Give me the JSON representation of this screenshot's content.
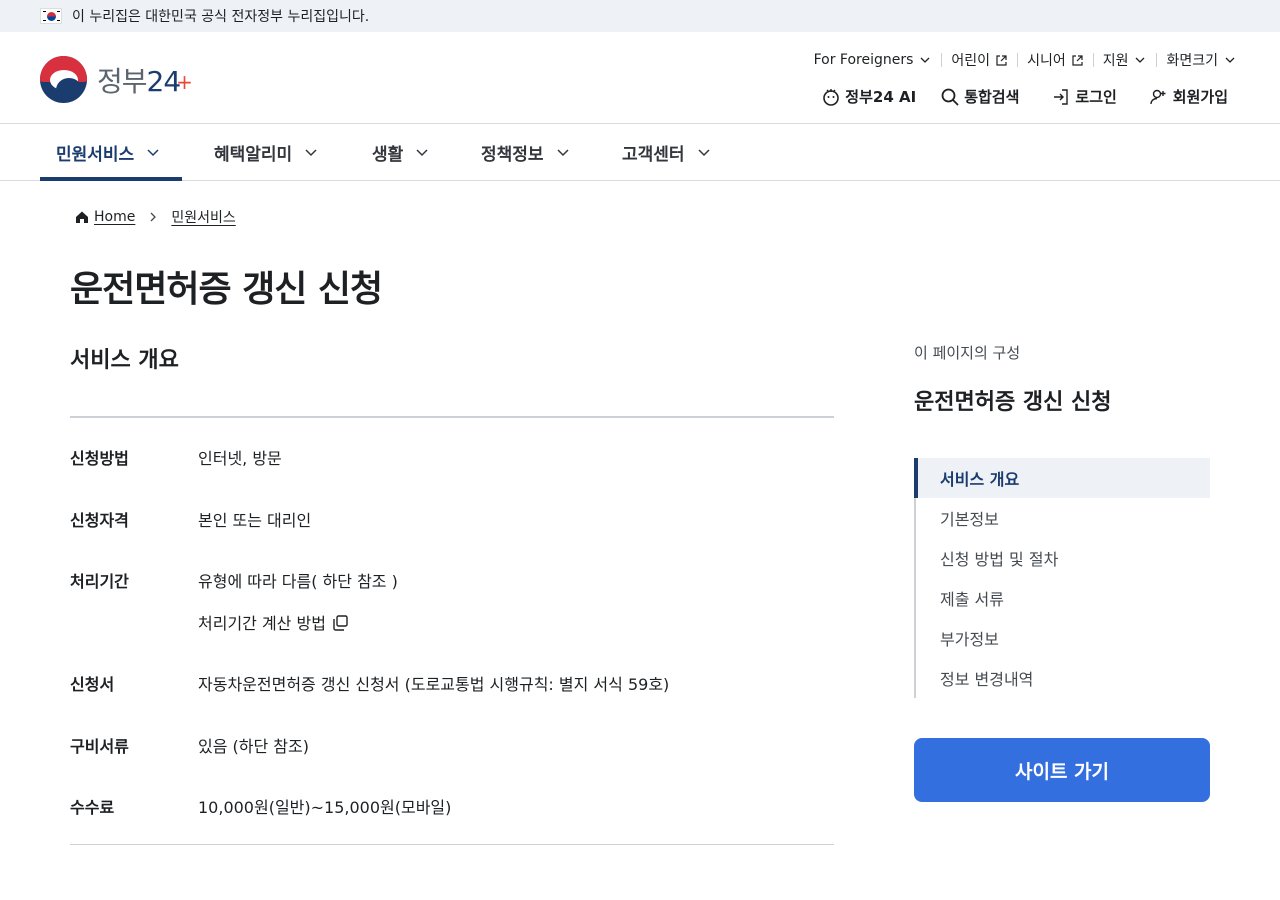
{
  "gov_banner": {
    "text": "이 누리집은 대한민국 공식 전자정부 누리집입니다."
  },
  "logo": {
    "text_main": "정부",
    "text_num": "24",
    "text_plus": "+"
  },
  "util_menu": [
    {
      "label": "For Foreigners",
      "icon": "chevron-down-icon"
    },
    {
      "label": "어린이",
      "icon": "external-link-icon"
    },
    {
      "label": "시니어",
      "icon": "external-link-icon"
    },
    {
      "label": "지원",
      "icon": "chevron-down-icon"
    },
    {
      "label": "화면크기",
      "icon": "chevron-down-icon"
    }
  ],
  "header_actions": {
    "ai": "정부24 AI",
    "search": "통합검색",
    "login": "로그인",
    "signup": "회원가입"
  },
  "nav": [
    {
      "label": "민원서비스",
      "active": true
    },
    {
      "label": "혜택알리미"
    },
    {
      "label": "생활"
    },
    {
      "label": "정책정보"
    },
    {
      "label": "고객센터"
    }
  ],
  "breadcrumb": {
    "home": "Home",
    "current": "민원서비스"
  },
  "page_title": "운전면허증 갱신 신청",
  "overview": {
    "title": "서비스 개요",
    "rows": [
      {
        "label": "신청방법",
        "value": "인터넷, 방문"
      },
      {
        "label": "신청자격",
        "value": "본인 또는 대리인"
      },
      {
        "label": "처리기간",
        "value": "유형에 따라 다름( 하단 참조 )"
      },
      {
        "label": "신청서",
        "value": "자동차운전면허증 갱신 신청서 (도로교통법 시행규칙: 별지 서식 59호)"
      },
      {
        "label": "구비서류",
        "value": "있음 (하단 참조)"
      },
      {
        "label": "수수료",
        "value": "10,000원(일반)~15,000원(모바일)"
      }
    ],
    "calc_link": "처리기간 계산 방법"
  },
  "toc": {
    "caption": "이 페이지의 구성",
    "title": "운전면허증 갱신 신청",
    "items": [
      {
        "label": "서비스 개요",
        "active": true
      },
      {
        "label": "기본정보"
      },
      {
        "label": "신청 방법 및 절차"
      },
      {
        "label": "제출 서류"
      },
      {
        "label": "부가정보"
      },
      {
        "label": "정보 변경내역"
      }
    ]
  },
  "site_button": "사이트 가기",
  "colors": {
    "navy": "#1b3c6e",
    "button_blue": "#346fe0",
    "banner_bg": "#eef1f6"
  }
}
